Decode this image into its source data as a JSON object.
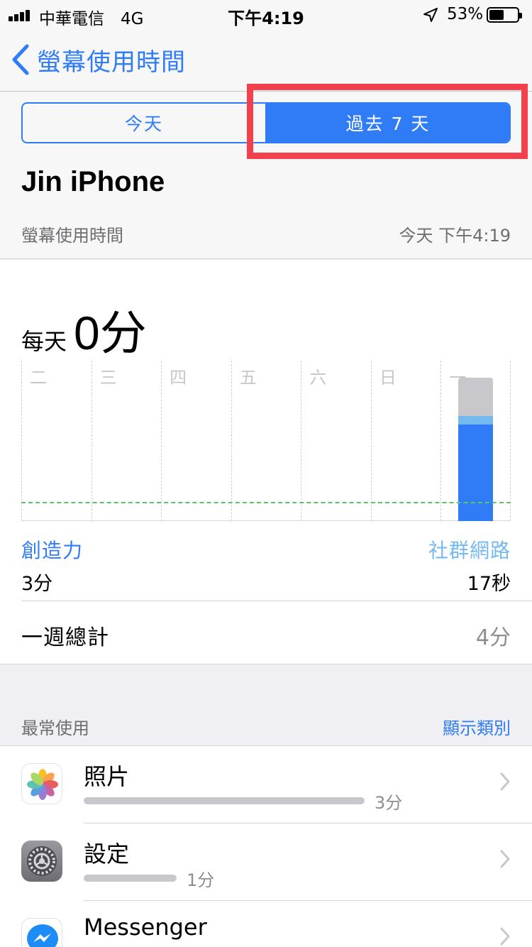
{
  "status_bar": {
    "carrier": "中華電信　4G",
    "time": "下午4:19",
    "battery": "53%",
    "battery_level": 0.53
  },
  "nav": {
    "back_label": "螢幕使用時間",
    "back_icon": "chevron-left-icon"
  },
  "segments": {
    "today": "今天",
    "last7": "過去 7 天",
    "selected": "last7"
  },
  "device": {
    "name": "Jin iPhone",
    "section_label": "螢幕使用時間",
    "updated": "今天 下午4:19"
  },
  "summary": {
    "daily_prefix": "每天",
    "daily_value": "0分",
    "category_left": {
      "name": "創造力",
      "value": "3分",
      "color": "#2f7cf6"
    },
    "category_right": {
      "name": "社群網路",
      "value": "17秒",
      "color": "#74baf0"
    },
    "total_label": "一週總計",
    "total_value": "4分"
  },
  "chart_data": {
    "type": "bar",
    "categories": [
      "二",
      "三",
      "四",
      "五",
      "六",
      "日",
      "一"
    ],
    "stacked": true,
    "series": [
      {
        "name": "創造力",
        "color": "#2f7cf6",
        "values": [
          0,
          0,
          0,
          0,
          0,
          0,
          3
        ]
      },
      {
        "name": "社群網路",
        "color": "#74baf0",
        "values": [
          0,
          0,
          0,
          0,
          0,
          0,
          0.28
        ]
      },
      {
        "color": "#c7c7cc",
        "values": [
          0,
          0,
          0,
          0,
          0,
          0,
          1.2
        ]
      }
    ],
    "average_line": 0.6,
    "ylim": [
      0,
      5
    ],
    "average_color": "#58c765"
  },
  "most_used": {
    "header": "最常使用",
    "show_categories": "顯示類別",
    "apps": [
      {
        "name": "照片",
        "time": "3分",
        "fraction": 1.0,
        "icon": "photos-icon"
      },
      {
        "name": "設定",
        "time": "1分",
        "fraction": 0.33,
        "icon": "settings-icon"
      },
      {
        "name": "Messenger",
        "time": "",
        "fraction": 0.1,
        "icon": "messenger-icon"
      }
    ]
  }
}
